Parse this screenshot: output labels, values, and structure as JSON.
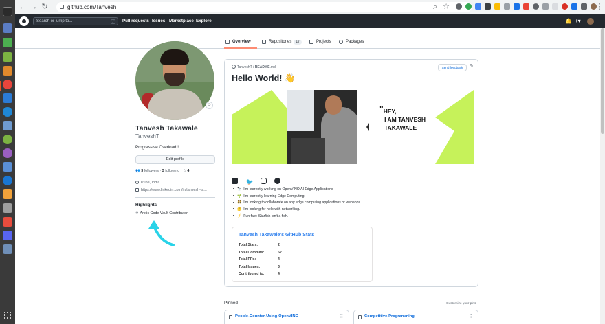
{
  "browser": {
    "url": "github.com/TanveshT"
  },
  "header": {
    "search_placeholder": "Search or jump to...",
    "search_shortcut": "/",
    "nav": [
      "Pull requests",
      "Issues",
      "Marketplace",
      "Explore"
    ]
  },
  "tabs": [
    {
      "label": "Overview",
      "active": true
    },
    {
      "label": "Repositories",
      "count": "17"
    },
    {
      "label": "Projects"
    },
    {
      "label": "Packages"
    }
  ],
  "profile": {
    "name": "Tanvesh Takawale",
    "username": "TanveshT",
    "bio": "Progressive Overload !",
    "edit_label": "Edit profile",
    "followers_count": "3",
    "followers_label": "followers",
    "following_count": "3",
    "following_label": "following",
    "stars_count": "4",
    "location": "Pune, India",
    "website": "https://www.linkedin.com/in/tanvesh-ta...",
    "highlights_title": "Highlights",
    "highlight": "Arctic Code Vault Contributor"
  },
  "readme": {
    "path_user": "TanveshT",
    "path_file": "README",
    "path_ext": ".md",
    "feedback_label": "Send feedback",
    "heading": "Hello World! 👋",
    "banner_quote": "\"",
    "banner_line1": "HEY,",
    "banner_line2": "I AM TANVESH",
    "banner_line3": "TAKAWALE",
    "bullets": [
      {
        "emoji": "🔭",
        "text": "I’m currently working on OpenVINO AI Edge Applications"
      },
      {
        "emoji": "🌱",
        "text": "I’m currently learning Edge Computing"
      },
      {
        "emoji": "👯",
        "text": "I’m looking to collaborate on any edge computing applications or webapps."
      },
      {
        "emoji": "🤔",
        "text": "I’m looking for help with networking."
      },
      {
        "emoji": "⚡",
        "text": "Fun fact: Starfish isn't a fish."
      }
    ],
    "stats": {
      "title": "Tanvesh Takawale's GitHub Stats",
      "rows": [
        {
          "label": "Total Stars:",
          "value": "2"
        },
        {
          "label": "Total Commits:",
          "value": "52"
        },
        {
          "label": "Total PRs:",
          "value": "4"
        },
        {
          "label": "Total Issues:",
          "value": "3"
        },
        {
          "label": "Contributed to:",
          "value": "4"
        }
      ]
    }
  },
  "pinned": {
    "title": "Pinned",
    "customize_label": "Customize your pins",
    "repos": [
      "People-Counter-Using-OpenVINO",
      "Competitive-Programming"
    ]
  },
  "colors": {
    "banner_accent": "#c6f25a",
    "arrow": "#29d3e8",
    "stats_title": "#2f80ed",
    "tab_underline": "#fd8c73"
  }
}
